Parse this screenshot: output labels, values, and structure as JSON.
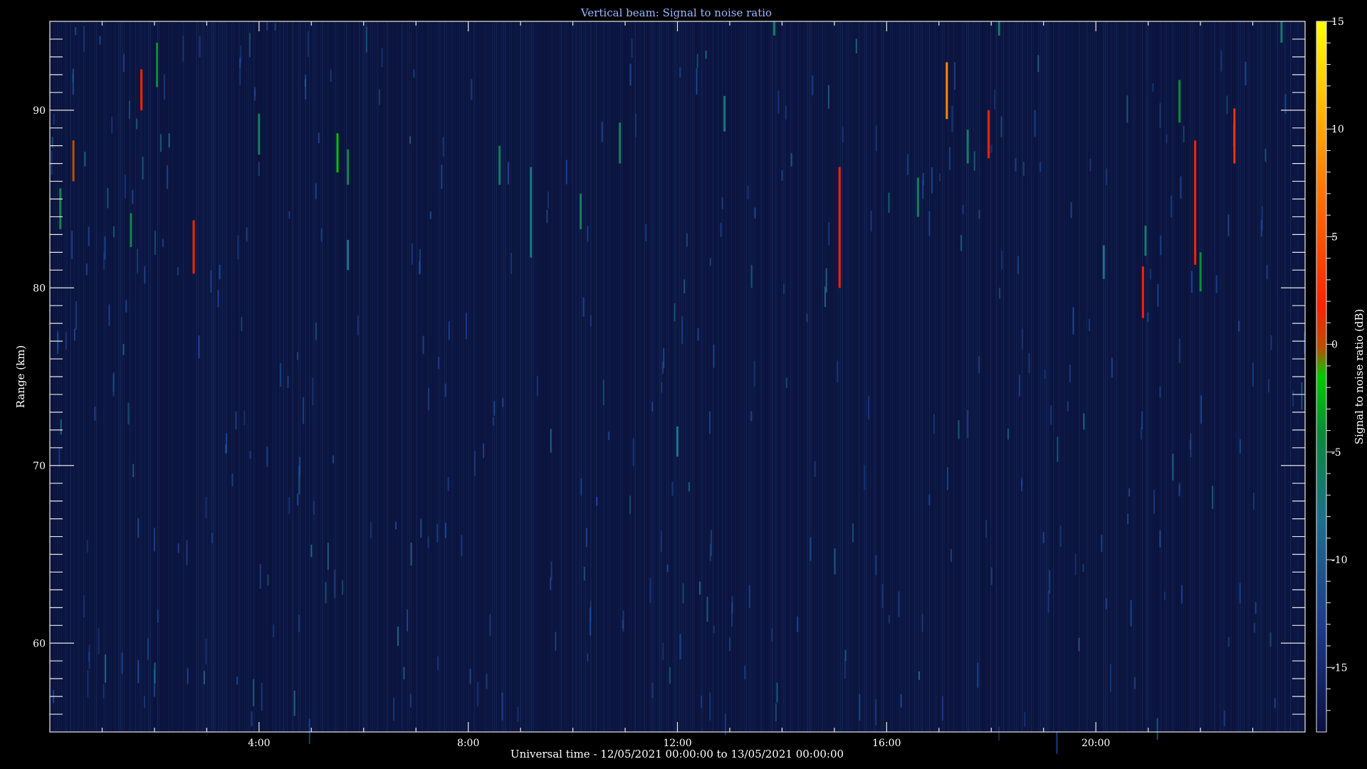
{
  "chart_data": {
    "type": "heatmap",
    "title": "Vertical beam: Signal to noise ratio",
    "xlabel": "Universal time - 12/05/2021 00:00:00 to 13/05/2021 00:00:00",
    "ylabel": "Range (km)",
    "colorbar_label": "Signal to noise ratio (dB)",
    "x_unit": "hours UT",
    "xlim": [
      0,
      24
    ],
    "ylim": [
      55,
      95
    ],
    "zlim": [
      -18,
      15
    ],
    "x_ticks": [
      {
        "value": 4,
        "label": "4:00"
      },
      {
        "value": 8,
        "label": "8:00"
      },
      {
        "value": 12,
        "label": "12:00"
      },
      {
        "value": 16,
        "label": "16:00"
      },
      {
        "value": 20,
        "label": "20:00"
      }
    ],
    "y_ticks": [
      {
        "value": 60,
        "label": "60"
      },
      {
        "value": 70,
        "label": "70"
      },
      {
        "value": 80,
        "label": "80"
      },
      {
        "value": 90,
        "label": "90"
      }
    ],
    "colorbar_ticks": [
      {
        "value": 15,
        "label": "15"
      },
      {
        "value": 10,
        "label": "10"
      },
      {
        "value": 5,
        "label": "5"
      },
      {
        "value": 0,
        "label": "0"
      },
      {
        "value": -5,
        "label": "-5"
      },
      {
        "value": -10,
        "label": "-10"
      },
      {
        "value": -15,
        "label": "-15"
      }
    ],
    "background_snr": -16,
    "colorscale": [
      "#0a1040",
      "#1e3a8a",
      "#1f6f8b",
      "#0a8a3a",
      "#00cc00",
      "#b85000",
      "#ff2000",
      "#ff8c00",
      "#ffff00"
    ],
    "echoes": [
      {
        "t": 0.2,
        "r0": 83.3,
        "r1": 85.6,
        "snr": -5
      },
      {
        "t": 0.45,
        "r0": 86.0,
        "r1": 88.3,
        "snr": 0
      },
      {
        "t": 1.55,
        "r0": 82.3,
        "r1": 84.2,
        "snr": -5
      },
      {
        "t": 1.75,
        "r0": 90.0,
        "r1": 92.3,
        "snr": 2
      },
      {
        "t": 2.05,
        "r0": 91.3,
        "r1": 93.8,
        "snr": -4
      },
      {
        "t": 2.75,
        "r0": 80.8,
        "r1": 83.8,
        "snr": 2
      },
      {
        "t": 4.0,
        "r0": 87.5,
        "r1": 89.8,
        "snr": -6
      },
      {
        "t": 5.5,
        "r0": 86.5,
        "r1": 88.7,
        "snr": -2
      },
      {
        "t": 5.7,
        "r0": 85.8,
        "r1": 87.8,
        "snr": -5
      },
      {
        "t": 5.7,
        "r0": 81.0,
        "r1": 82.7,
        "snr": -8
      },
      {
        "t": 8.6,
        "r0": 85.8,
        "r1": 88.0,
        "snr": -6
      },
      {
        "t": 9.2,
        "r0": 81.7,
        "r1": 86.8,
        "snr": -7
      },
      {
        "t": 10.15,
        "r0": 83.3,
        "r1": 85.3,
        "snr": -6
      },
      {
        "t": 10.9,
        "r0": 87.0,
        "r1": 89.3,
        "snr": -6
      },
      {
        "t": 12.0,
        "r0": 70.5,
        "r1": 72.2,
        "snr": -8
      },
      {
        "t": 12.9,
        "r0": 88.8,
        "r1": 90.8,
        "snr": -7
      },
      {
        "t": 13.85,
        "r0": 94.2,
        "r1": 95.0,
        "snr": -6
      },
      {
        "t": 15.1,
        "r0": 80.0,
        "r1": 86.8,
        "snr": 2
      },
      {
        "t": 16.6,
        "r0": 84.0,
        "r1": 86.2,
        "snr": -6
      },
      {
        "t": 17.15,
        "r0": 89.5,
        "r1": 92.7,
        "snr": 8
      },
      {
        "t": 17.55,
        "r0": 87.0,
        "r1": 88.9,
        "snr": -6
      },
      {
        "t": 17.95,
        "r0": 87.3,
        "r1": 90.0,
        "snr": 2
      },
      {
        "t": 18.15,
        "r0": 94.2,
        "r1": 95.0,
        "snr": -6
      },
      {
        "t": 20.15,
        "r0": 80.5,
        "r1": 82.4,
        "snr": -8
      },
      {
        "t": 20.9,
        "r0": 78.3,
        "r1": 81.2,
        "snr": 2
      },
      {
        "t": 20.95,
        "r0": 81.8,
        "r1": 83.5,
        "snr": -7
      },
      {
        "t": 21.6,
        "r0": 89.3,
        "r1": 91.7,
        "snr": -4
      },
      {
        "t": 21.9,
        "r0": 81.3,
        "r1": 88.3,
        "snr": 2
      },
      {
        "t": 22.0,
        "r0": 79.8,
        "r1": 82.0,
        "snr": -4
      },
      {
        "t": 22.65,
        "r0": 87.0,
        "r1": 90.1,
        "snr": 3
      },
      {
        "t": 23.55,
        "r0": 93.8,
        "r1": 95.0,
        "snr": -7
      }
    ]
  }
}
